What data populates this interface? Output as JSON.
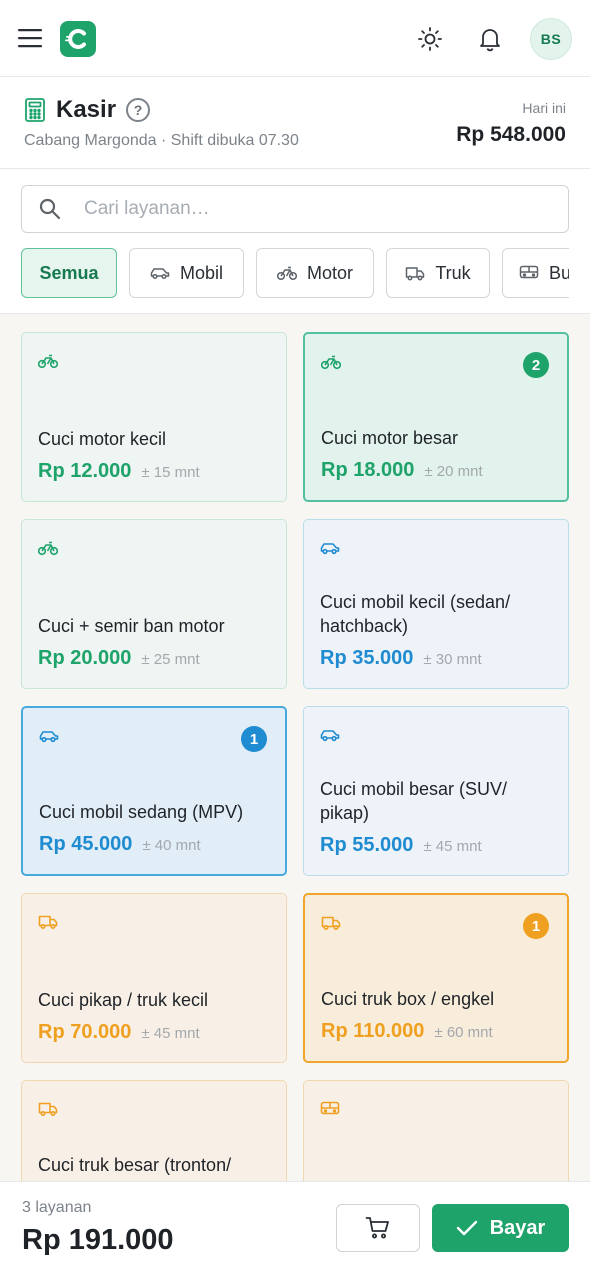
{
  "header": {
    "title": "Kasir",
    "help": "?",
    "subtitle": "Cabang Margonda · Shift dibuka 07.30",
    "today_label": "Hari ini",
    "today_value": "Rp 548.000"
  },
  "user": {
    "initials": "BS"
  },
  "search": {
    "placeholder": "Cari layanan…",
    "value": ""
  },
  "filters": [
    {
      "label": "Semua",
      "icon": "none",
      "active": true
    },
    {
      "label": "Mobil",
      "icon": "car-icon",
      "active": false
    },
    {
      "label": "Motor",
      "icon": "bike-icon",
      "active": false
    },
    {
      "label": "Truk",
      "icon": "truck-icon",
      "active": false
    },
    {
      "label": "Bus",
      "icon": "bus-icon",
      "active": false
    }
  ],
  "services": [
    {
      "name": "Cuci motor kecil",
      "price": "Rp 12.000",
      "duration": "± 15 mnt",
      "type": "motor",
      "qty": ""
    },
    {
      "name": "Cuci motor besar",
      "price": "Rp 18.000",
      "duration": "± 20 mnt",
      "type": "motor",
      "qty": "2"
    },
    {
      "name": "Cuci + semir ban motor",
      "price": "Rp 20.000",
      "duration": "± 25 mnt",
      "type": "motor",
      "qty": ""
    },
    {
      "name": "Cuci mobil kecil (sedan/ hatchback)",
      "price": "Rp 35.000",
      "duration": "± 30 mnt",
      "type": "mobil",
      "qty": ""
    },
    {
      "name": "Cuci mobil sedang (MPV)",
      "price": "Rp 45.000",
      "duration": "± 40 mnt",
      "type": "mobil",
      "qty": "1"
    },
    {
      "name": "Cuci mobil besar (SUV/ pikap)",
      "price": "Rp 55.000",
      "duration": "± 45 mnt",
      "type": "mobil",
      "qty": ""
    },
    {
      "name": "Cuci pikap / truk kecil",
      "price": "Rp 70.000",
      "duration": "± 45 mnt",
      "type": "truk",
      "qty": ""
    },
    {
      "name": "Cuci truk box / engkel",
      "price": "Rp 110.000",
      "duration": "± 60 mnt",
      "type": "truk",
      "qty": "1"
    },
    {
      "name": "Cuci truk besar (tronton/",
      "price": "",
      "duration": "",
      "type": "truk",
      "qty": ""
    },
    {
      "name": "",
      "price": "",
      "duration": "",
      "type": "bus",
      "qty": ""
    }
  ],
  "cart": {
    "count": "3 layanan",
    "total": "Rp 191.000",
    "pay_label": "Bayar"
  },
  "colors": {
    "brand": "#1ea36b",
    "motor": "#1ea36b",
    "mobil": "#1f8bd0",
    "truk": "#f0a020"
  }
}
